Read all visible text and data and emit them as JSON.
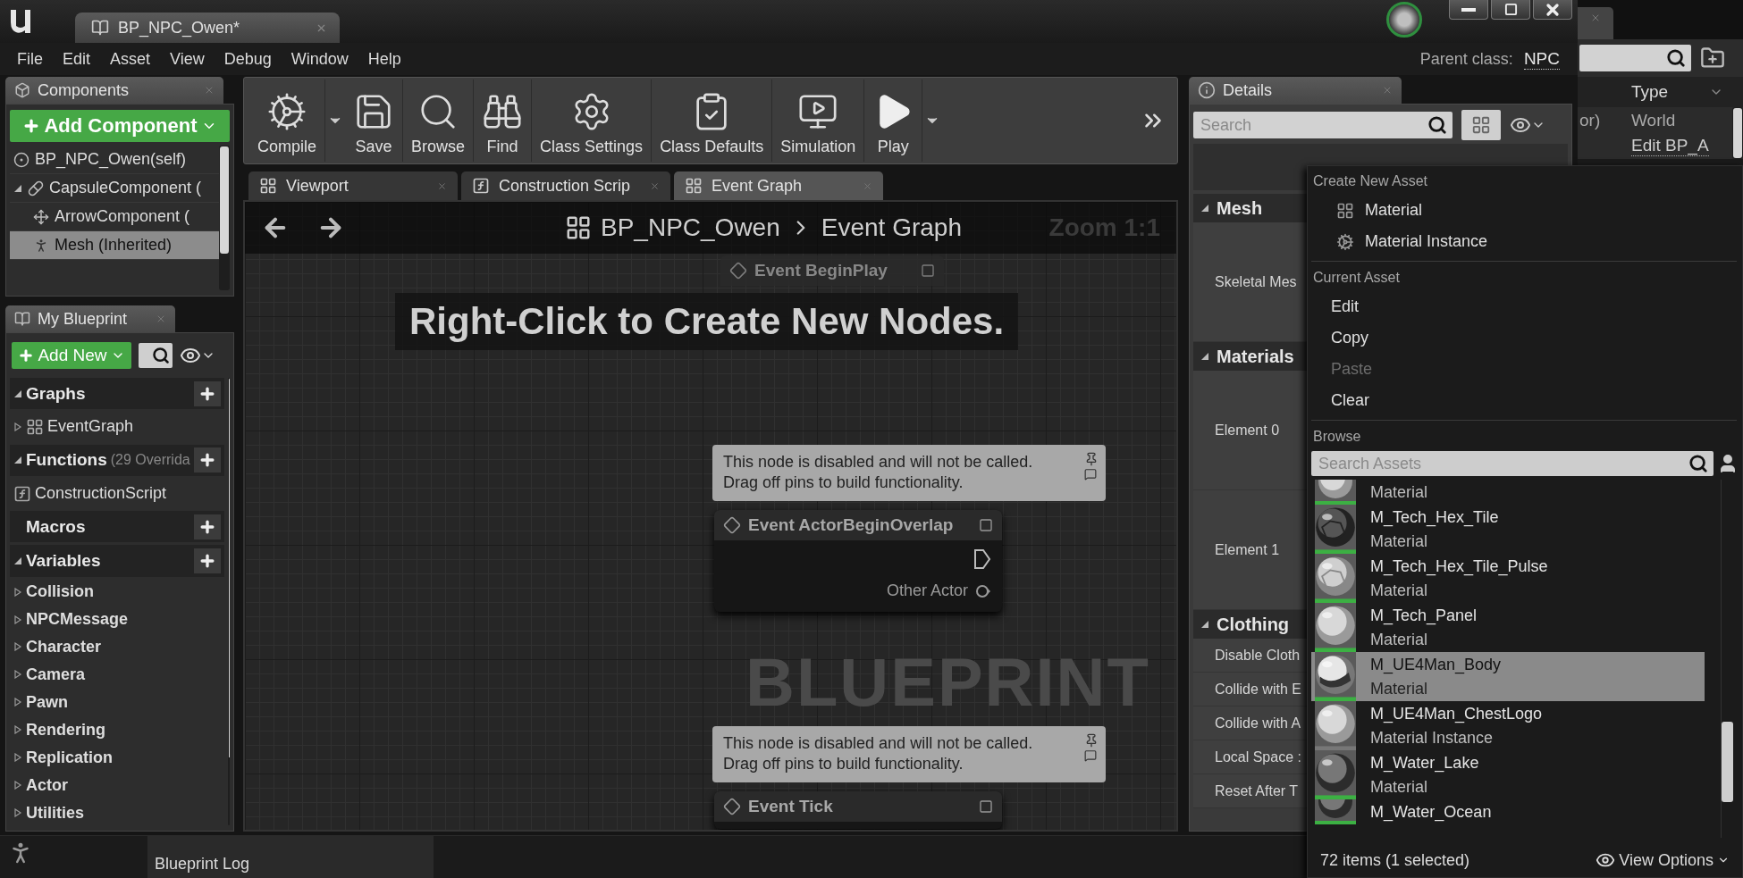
{
  "title_bar": {
    "document_tab": "BP_NPC_Owen*"
  },
  "menu": [
    "File",
    "Edit",
    "Asset",
    "View",
    "Debug",
    "Window",
    "Help"
  ],
  "parent_class": {
    "label": "Parent class:",
    "value": "NPC"
  },
  "components": {
    "title": "Components",
    "add_button": "Add Component",
    "tree": [
      {
        "label": "BP_NPC_Owen(self)",
        "kind": "self",
        "selected": false
      },
      {
        "label": "CapsuleComponent (",
        "kind": "capsule",
        "selected": false,
        "children": [
          {
            "label": "ArrowComponent (",
            "kind": "arrow",
            "selected": false
          },
          {
            "label": "Mesh (Inherited)",
            "kind": "mesh",
            "selected": true
          }
        ]
      }
    ]
  },
  "my_blueprint": {
    "title": "My Blueprint",
    "add_button": "Add New",
    "sections": [
      {
        "title": "Graphs",
        "items": [
          {
            "label": "EventGraph",
            "kind": "graph"
          }
        ]
      },
      {
        "title": "Functions",
        "note": "(29 Overrida",
        "items": [
          {
            "label": "ConstructionScript",
            "kind": "function"
          }
        ]
      },
      {
        "title": "Macros"
      },
      {
        "title": "Variables",
        "items": [
          {
            "label": "Collision",
            "kind": "category"
          },
          {
            "label": "NPCMessage",
            "kind": "category"
          },
          {
            "label": "Character",
            "kind": "category"
          },
          {
            "label": "Camera",
            "kind": "category"
          },
          {
            "label": "Pawn",
            "kind": "category"
          },
          {
            "label": "Rendering",
            "kind": "category"
          },
          {
            "label": "Replication",
            "kind": "category"
          },
          {
            "label": "Actor",
            "kind": "category"
          },
          {
            "label": "Utilities",
            "kind": "category"
          }
        ]
      }
    ]
  },
  "toolbar": [
    {
      "label": "Compile",
      "kind": "compile",
      "menu": true
    },
    {
      "label": "Save",
      "kind": "save",
      "menu": false
    },
    {
      "label": "Browse",
      "kind": "browse",
      "menu": false
    },
    {
      "label": "Find",
      "kind": "find",
      "menu": false
    },
    {
      "label": "Class Settings",
      "kind": "class_settings",
      "menu": false
    },
    {
      "label": "Class Defaults",
      "kind": "class_defaults",
      "menu": false
    },
    {
      "label": "Simulation",
      "kind": "simulation",
      "menu": false
    },
    {
      "label": "Play",
      "kind": "play",
      "menu": true
    }
  ],
  "editor_tabs": [
    {
      "label": "Viewport",
      "kind": "viewport",
      "selected": false
    },
    {
      "label": "Construction Scrip",
      "kind": "function",
      "selected": false
    },
    {
      "label": "Event Graph",
      "kind": "graph",
      "selected": true
    }
  ],
  "graph": {
    "breadcrumb": [
      "BP_NPC_Owen",
      "Event Graph"
    ],
    "zoom": "Zoom 1:1",
    "hint": "Right-Click to Create New Nodes.",
    "watermark": "BLUEPRINT",
    "nodes": [
      {
        "kind": "ghost",
        "title": "Event BeginPlay"
      },
      {
        "kind": "event",
        "comment": "This node is disabled and will not be called.\nDrag off pins to build functionality.",
        "title": "Event ActorBeginOverlap",
        "pins": [
          "Other Actor"
        ]
      },
      {
        "kind": "event",
        "comment": "This node is disabled and will not be called.\nDrag off pins to build functionality.",
        "title": "Event Tick"
      }
    ]
  },
  "details": {
    "title": "Details",
    "search_placeholder": "Search",
    "sections": [
      {
        "title": "Mesh",
        "kind": "asset",
        "rows": [
          "Skeletal Mes"
        ]
      },
      {
        "title": "Materials",
        "kind": "asset",
        "rows": [
          "Element 0",
          "Element 1"
        ]
      },
      {
        "title": "Clothing",
        "kind": "property",
        "rows": [
          "Disable Cloth",
          "Collide with E",
          "Collide with A",
          "Local Space :",
          "Reset After T"
        ]
      }
    ]
  },
  "side_window": {
    "column": "Type",
    "rows": [
      {
        "column_1": "or)",
        "type": "World",
        "kind": "text"
      },
      {
        "type": "Edit BP_A",
        "kind": "link"
      }
    ]
  },
  "asset_menu": {
    "sections": [
      {
        "heading": "Create New Asset",
        "items": [
          {
            "label": "Material",
            "kind": "material",
            "disabled": false
          },
          {
            "label": "Material Instance",
            "kind": "instance",
            "disabled": false
          }
        ]
      },
      {
        "heading": "Current Asset",
        "items": [
          {
            "label": "Edit",
            "kind": "plain",
            "disabled": false
          },
          {
            "label": "Copy",
            "kind": "plain",
            "disabled": false
          },
          {
            "label": "Paste",
            "kind": "plain",
            "disabled": true
          },
          {
            "label": "Clear",
            "kind": "plain",
            "disabled": false
          }
        ]
      }
    ],
    "browse": {
      "heading": "Browse",
      "placeholder": "Search Assets",
      "assets": [
        {
          "type": "Material",
          "kind": "plain",
          "selected": false
        },
        {
          "name": "M_Tech_Hex_Tile",
          "type": "Material",
          "kind": "hex",
          "selected": false
        },
        {
          "name": "M_Tech_Hex_Tile_Pulse",
          "type": "Material",
          "kind": "hex_light",
          "selected": false
        },
        {
          "name": "M_Tech_Panel",
          "type": "Material",
          "kind": "plain",
          "selected": false
        },
        {
          "name": "M_UE4Man_Body",
          "type": "Material",
          "kind": "body",
          "selected": true
        },
        {
          "name": "M_UE4Man_ChestLogo",
          "type": "Material Instance",
          "kind": "plain",
          "selected": false
        },
        {
          "name": "M_Water_Lake",
          "type": "Material",
          "kind": "dark",
          "selected": false
        },
        {
          "name": "M_Water_Ocean",
          "kind": "dark",
          "selected": false
        }
      ],
      "count": "72 items (1 selected)",
      "view_options": "View Options"
    }
  },
  "bottom_tabs": [
    "Blueprint Log"
  ]
}
